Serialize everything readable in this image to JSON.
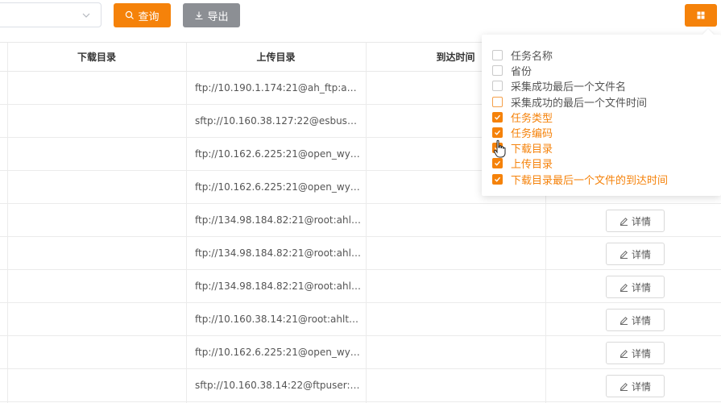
{
  "toolbar": {
    "select_value": "",
    "query_label": "查询",
    "export_label": "导出",
    "accent_color": "#f5820a",
    "export_color": "#8c8f94",
    "query_icon": "search-icon",
    "export_icon": "download-icon",
    "columns_icon": "grid-icon"
  },
  "table": {
    "columns": [
      "下载目录",
      "上传目录",
      "到达时间"
    ],
    "detail_label": "详情",
    "detail_icon": "edit-icon",
    "rows": [
      {
        "upload_dir": "ftp://10.190.1.174:21@ah_ftp:ahe…",
        "show_detail": false
      },
      {
        "upload_dir": "sftp://10.160.38.127:22@esbuser:…",
        "show_detail": false
      },
      {
        "upload_dir": "ftp://10.162.6.225:21@open_wy_…",
        "show_detail": false
      },
      {
        "upload_dir": "ftp://10.162.6.225:21@open_wy_…",
        "show_detail": false
      },
      {
        "upload_dir": "ftp://134.98.184.82:21@root:ahlt…",
        "show_detail": true
      },
      {
        "upload_dir": "ftp://134.98.184.82:21@root:ahlt…",
        "show_detail": true
      },
      {
        "upload_dir": "ftp://134.98.184.82:21@root:ahlt…",
        "show_detail": true
      },
      {
        "upload_dir": "ftp://10.160.38.14:21@root:ahlt$…",
        "show_detail": true
      },
      {
        "upload_dir": "ftp://10.162.6.225:21@open_wy_…",
        "show_detail": true
      },
      {
        "upload_dir": "sftp://10.160.38.14:22@ftpuser:ft…",
        "show_detail": true
      }
    ]
  },
  "column_picker": {
    "options": [
      {
        "label": "任务名称",
        "checked": false
      },
      {
        "label": "省份",
        "checked": false
      },
      {
        "label": "采集成功最后一个文件名",
        "checked": false
      },
      {
        "label": "采集成功的最后一个文件时间",
        "checked": false
      },
      {
        "label": "任务类型",
        "checked": true
      },
      {
        "label": "任务编码",
        "checked": true
      },
      {
        "label": "下载目录",
        "checked": true
      },
      {
        "label": "上传目录",
        "checked": true
      },
      {
        "label": "下载目录最后一个文件的到达时间",
        "checked": true
      }
    ]
  }
}
